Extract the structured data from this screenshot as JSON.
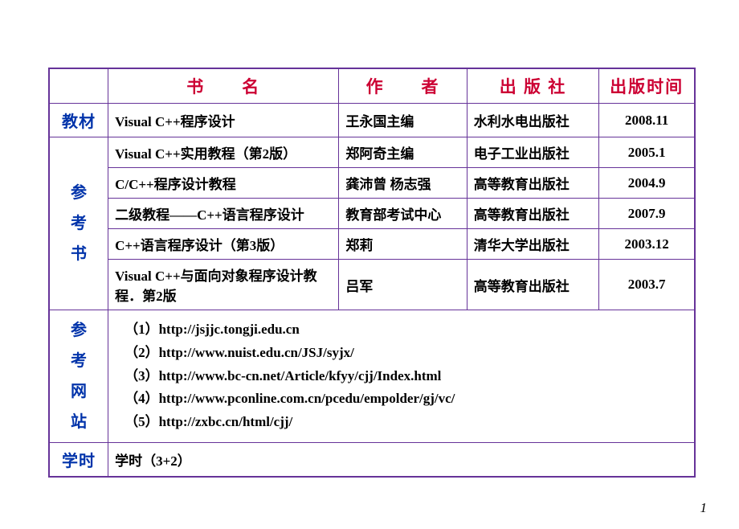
{
  "headers": {
    "book": "书　　名",
    "author": "作　　者",
    "publisher": "出  版  社",
    "pubtime": "出版时间"
  },
  "labels": {
    "textbook": "教材",
    "refbook_c1": "参",
    "refbook_c2": "考",
    "refbook_c3": "书",
    "refsite_c1": "参",
    "refsite_c2": "考",
    "refsite_c3": "网",
    "refsite_c4": "站",
    "hours": "学时"
  },
  "textbook": {
    "name": "Visual C++程序设计",
    "author": "王永国主编",
    "publisher": "水利水电出版社",
    "pubtime": "2008.11"
  },
  "refs": [
    {
      "name": "Visual C++实用教程（第2版）",
      "author": "郑阿奇主编",
      "publisher": "电子工业出版社",
      "pubtime": "2005.1"
    },
    {
      "name": "C/C++程序设计教程",
      "author": "龚沛曾  杨志强",
      "publisher": "高等教育出版社",
      "pubtime": "2004.9"
    },
    {
      "name": "二级教程——C++语言程序设计",
      "author": "教育部考试中心",
      "publisher": "高等教育出版社",
      "pubtime": "2007.9"
    },
    {
      "name": "C++语言程序设计（第3版）",
      "author": "郑莉",
      "publisher": "清华大学出版社",
      "pubtime": "2003.12"
    },
    {
      "name": "Visual C++与面向对象程序设计教程．第2版",
      "author": "吕军",
      "publisher": "高等教育出版社",
      "pubtime": "2003.7"
    }
  ],
  "sites": {
    "s1": "（1）http://jsjjc.tongji.edu.cn",
    "s2": "（2）http://www.nuist.edu.cn/JSJ/syjx/",
    "s3": "（3）http://www.bc-cn.net/Article/kfyy/cjj/Index.html",
    "s4": "（4）http://www.pconline.com.cn/pcedu/empolder/gj/vc/",
    "s5": "（5）http://zxbc.cn/html/cjj/"
  },
  "hours_value": "学时（3+2）",
  "page": "1"
}
